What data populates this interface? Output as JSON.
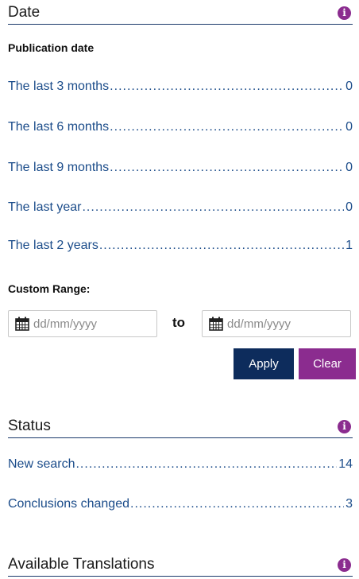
{
  "date_section": {
    "title": "Date",
    "publication_label": "Publication date",
    "items": [
      {
        "label": "The last 3 months",
        "count": "0"
      },
      {
        "label": "The last 6 months",
        "count": "0"
      },
      {
        "label": "The last 9 months",
        "count": "0"
      },
      {
        "label": "The last year",
        "count": "0"
      },
      {
        "label": "The last 2 years",
        "count": "1"
      }
    ],
    "custom_range_label": "Custom Range:",
    "from_placeholder": "dd/mm/yyyy",
    "to_label": "to",
    "to_placeholder": "dd/mm/yyyy",
    "apply_label": "Apply",
    "clear_label": "Clear"
  },
  "status_section": {
    "title": "Status",
    "items": [
      {
        "label": "New search",
        "count": "14"
      },
      {
        "label": "Conclusions changed",
        "count": "3"
      }
    ]
  },
  "translations_section": {
    "title": "Available Translations"
  },
  "icons": {
    "info": "info-icon",
    "calendar": "calendar-icon"
  },
  "colors": {
    "link": "#1b4c8a",
    "header_rule": "#1b3a6b",
    "apply_bg": "#0d2c5c",
    "clear_bg": "#8b2c8f",
    "info_icon": "#8b2c8f"
  }
}
